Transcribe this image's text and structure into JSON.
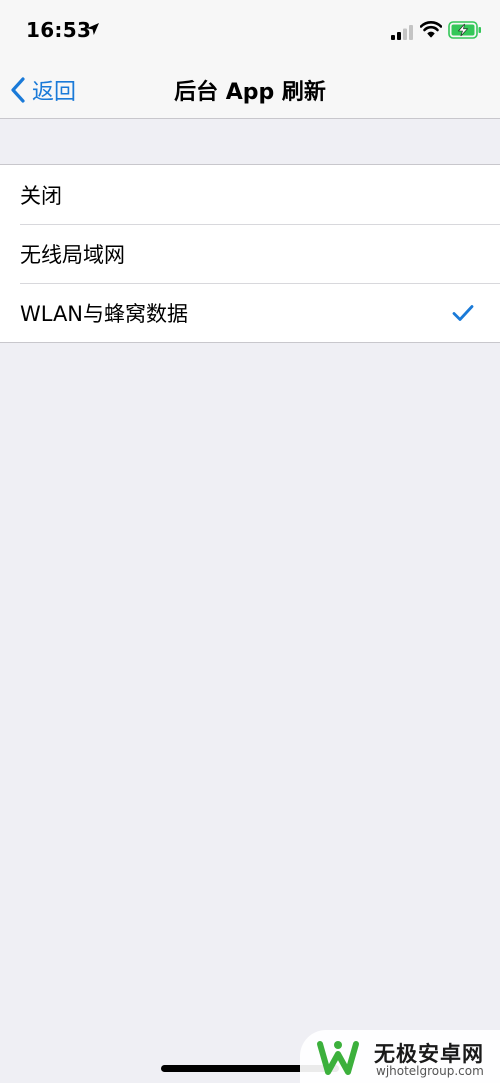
{
  "status_bar": {
    "time": "16:53",
    "icons": [
      "location-arrow-icon",
      "cellular-signal-icon",
      "wifi-icon",
      "battery-charging-icon"
    ],
    "battery_color": "#34c759"
  },
  "nav": {
    "back_label": "返回",
    "title": "后台 App 刷新"
  },
  "options": {
    "items": [
      {
        "label": "关闭",
        "selected": false
      },
      {
        "label": "无线局域网",
        "selected": false
      },
      {
        "label": "WLAN与蜂窝数据",
        "selected": true
      }
    ]
  },
  "watermark": {
    "title": "无极安卓网",
    "url": "wjhotelgroup.com"
  },
  "colors": {
    "accent": "#1a7ad8",
    "background": "#efeff4",
    "watermark_green": "#3cb03c"
  }
}
